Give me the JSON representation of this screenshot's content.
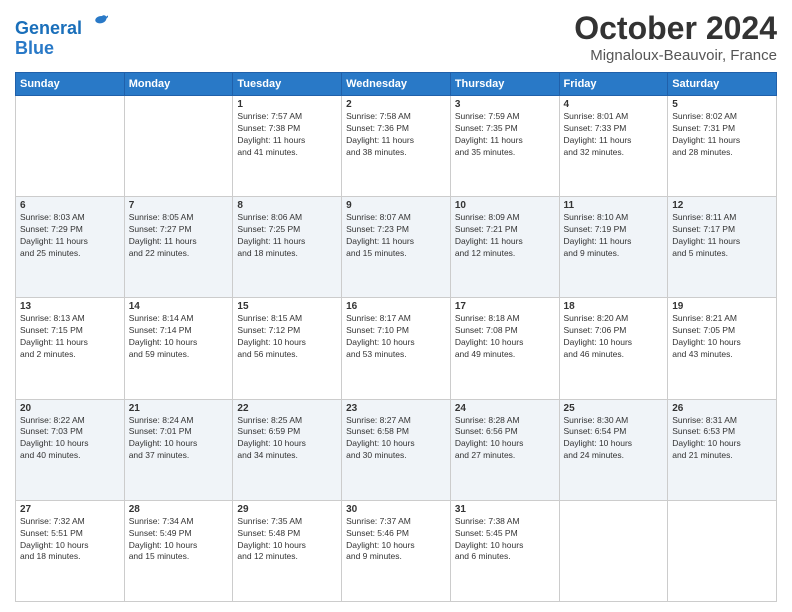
{
  "header": {
    "logo_line1": "General",
    "logo_line2": "Blue",
    "month": "October 2024",
    "location": "Mignaloux-Beauvoir, France"
  },
  "columns": [
    "Sunday",
    "Monday",
    "Tuesday",
    "Wednesday",
    "Thursday",
    "Friday",
    "Saturday"
  ],
  "weeks": [
    [
      {
        "day": "",
        "detail": ""
      },
      {
        "day": "",
        "detail": ""
      },
      {
        "day": "1",
        "detail": "Sunrise: 7:57 AM\nSunset: 7:38 PM\nDaylight: 11 hours\nand 41 minutes."
      },
      {
        "day": "2",
        "detail": "Sunrise: 7:58 AM\nSunset: 7:36 PM\nDaylight: 11 hours\nand 38 minutes."
      },
      {
        "day": "3",
        "detail": "Sunrise: 7:59 AM\nSunset: 7:35 PM\nDaylight: 11 hours\nand 35 minutes."
      },
      {
        "day": "4",
        "detail": "Sunrise: 8:01 AM\nSunset: 7:33 PM\nDaylight: 11 hours\nand 32 minutes."
      },
      {
        "day": "5",
        "detail": "Sunrise: 8:02 AM\nSunset: 7:31 PM\nDaylight: 11 hours\nand 28 minutes."
      }
    ],
    [
      {
        "day": "6",
        "detail": "Sunrise: 8:03 AM\nSunset: 7:29 PM\nDaylight: 11 hours\nand 25 minutes."
      },
      {
        "day": "7",
        "detail": "Sunrise: 8:05 AM\nSunset: 7:27 PM\nDaylight: 11 hours\nand 22 minutes."
      },
      {
        "day": "8",
        "detail": "Sunrise: 8:06 AM\nSunset: 7:25 PM\nDaylight: 11 hours\nand 18 minutes."
      },
      {
        "day": "9",
        "detail": "Sunrise: 8:07 AM\nSunset: 7:23 PM\nDaylight: 11 hours\nand 15 minutes."
      },
      {
        "day": "10",
        "detail": "Sunrise: 8:09 AM\nSunset: 7:21 PM\nDaylight: 11 hours\nand 12 minutes."
      },
      {
        "day": "11",
        "detail": "Sunrise: 8:10 AM\nSunset: 7:19 PM\nDaylight: 11 hours\nand 9 minutes."
      },
      {
        "day": "12",
        "detail": "Sunrise: 8:11 AM\nSunset: 7:17 PM\nDaylight: 11 hours\nand 5 minutes."
      }
    ],
    [
      {
        "day": "13",
        "detail": "Sunrise: 8:13 AM\nSunset: 7:15 PM\nDaylight: 11 hours\nand 2 minutes."
      },
      {
        "day": "14",
        "detail": "Sunrise: 8:14 AM\nSunset: 7:14 PM\nDaylight: 10 hours\nand 59 minutes."
      },
      {
        "day": "15",
        "detail": "Sunrise: 8:15 AM\nSunset: 7:12 PM\nDaylight: 10 hours\nand 56 minutes."
      },
      {
        "day": "16",
        "detail": "Sunrise: 8:17 AM\nSunset: 7:10 PM\nDaylight: 10 hours\nand 53 minutes."
      },
      {
        "day": "17",
        "detail": "Sunrise: 8:18 AM\nSunset: 7:08 PM\nDaylight: 10 hours\nand 49 minutes."
      },
      {
        "day": "18",
        "detail": "Sunrise: 8:20 AM\nSunset: 7:06 PM\nDaylight: 10 hours\nand 46 minutes."
      },
      {
        "day": "19",
        "detail": "Sunrise: 8:21 AM\nSunset: 7:05 PM\nDaylight: 10 hours\nand 43 minutes."
      }
    ],
    [
      {
        "day": "20",
        "detail": "Sunrise: 8:22 AM\nSunset: 7:03 PM\nDaylight: 10 hours\nand 40 minutes."
      },
      {
        "day": "21",
        "detail": "Sunrise: 8:24 AM\nSunset: 7:01 PM\nDaylight: 10 hours\nand 37 minutes."
      },
      {
        "day": "22",
        "detail": "Sunrise: 8:25 AM\nSunset: 6:59 PM\nDaylight: 10 hours\nand 34 minutes."
      },
      {
        "day": "23",
        "detail": "Sunrise: 8:27 AM\nSunset: 6:58 PM\nDaylight: 10 hours\nand 30 minutes."
      },
      {
        "day": "24",
        "detail": "Sunrise: 8:28 AM\nSunset: 6:56 PM\nDaylight: 10 hours\nand 27 minutes."
      },
      {
        "day": "25",
        "detail": "Sunrise: 8:30 AM\nSunset: 6:54 PM\nDaylight: 10 hours\nand 24 minutes."
      },
      {
        "day": "26",
        "detail": "Sunrise: 8:31 AM\nSunset: 6:53 PM\nDaylight: 10 hours\nand 21 minutes."
      }
    ],
    [
      {
        "day": "27",
        "detail": "Sunrise: 7:32 AM\nSunset: 5:51 PM\nDaylight: 10 hours\nand 18 minutes."
      },
      {
        "day": "28",
        "detail": "Sunrise: 7:34 AM\nSunset: 5:49 PM\nDaylight: 10 hours\nand 15 minutes."
      },
      {
        "day": "29",
        "detail": "Sunrise: 7:35 AM\nSunset: 5:48 PM\nDaylight: 10 hours\nand 12 minutes."
      },
      {
        "day": "30",
        "detail": "Sunrise: 7:37 AM\nSunset: 5:46 PM\nDaylight: 10 hours\nand 9 minutes."
      },
      {
        "day": "31",
        "detail": "Sunrise: 7:38 AM\nSunset: 5:45 PM\nDaylight: 10 hours\nand 6 minutes."
      },
      {
        "day": "",
        "detail": ""
      },
      {
        "day": "",
        "detail": ""
      }
    ]
  ]
}
